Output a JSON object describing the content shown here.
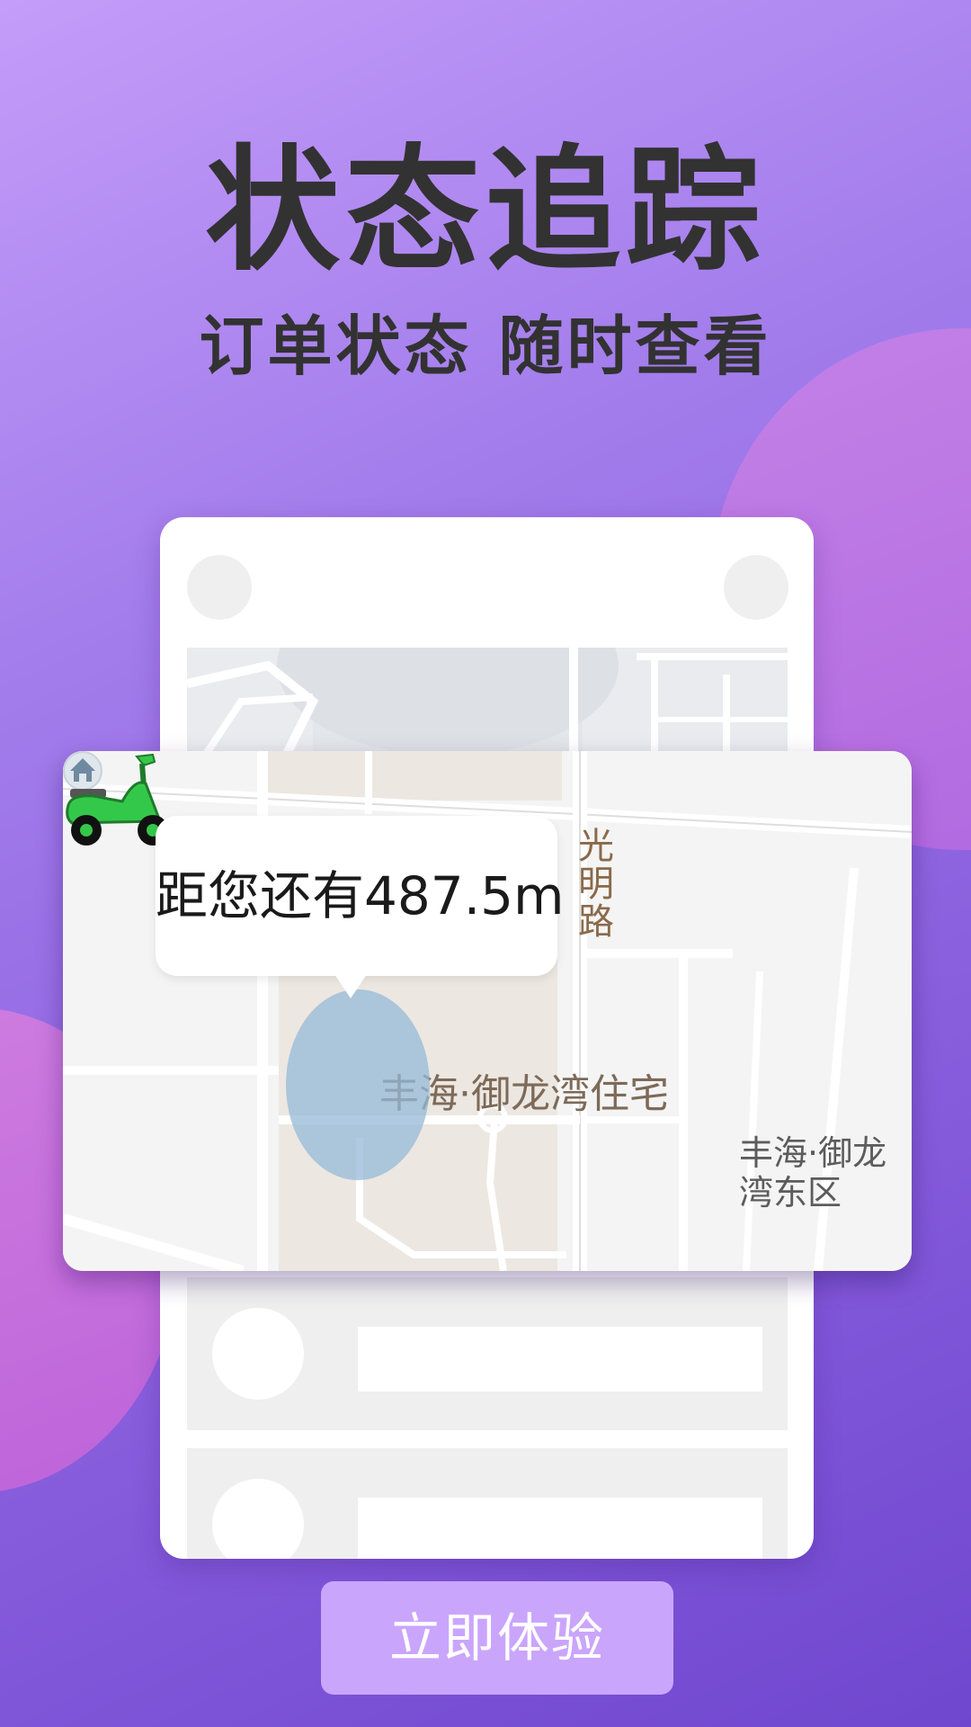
{
  "headline": {
    "title": "状态追踪",
    "subtitle": "订单状态 随时查看"
  },
  "map": {
    "distance_text": "距您还有487.5m",
    "road_name": [
      "光",
      "明",
      "路"
    ],
    "poi_main": "丰海·御龙湾住宅",
    "poi_secondary_line1": "丰海·御龙",
    "poi_secondary_line2": "湾东区",
    "rider_icon": "scooter-icon",
    "poi_icon": "home-pin-icon"
  },
  "cta": {
    "label": "立即体验"
  },
  "colors": {
    "background_top": "#c49cf9",
    "background_bottom": "#6f47cf",
    "cta_background": "#caa5fc",
    "scooter_green": "#34c84a"
  }
}
